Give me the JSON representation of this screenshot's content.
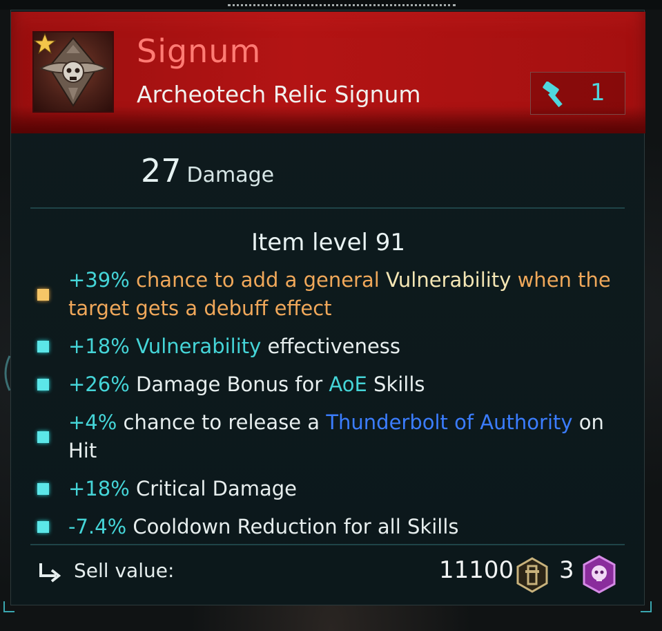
{
  "item": {
    "name": "Signum",
    "type": "Archeotech Relic Signum",
    "upgrade_count": "1",
    "damage_value": "27",
    "damage_label": "Damage",
    "item_level": "Item level 91"
  },
  "mods": [
    {
      "bullet": "gold",
      "parts": [
        {
          "t": "+39%",
          "c": "cyan"
        },
        {
          "t": " chance to add a general ",
          "c": "orange"
        },
        {
          "t": "Vulnerability",
          "c": "cream"
        },
        {
          "t": " when the target gets a debuff effect",
          "c": "orange"
        }
      ]
    },
    {
      "bullet": "cyan",
      "parts": [
        {
          "t": "+18%",
          "c": "cyan"
        },
        {
          "t": " "
        },
        {
          "t": "Vulnerability",
          "c": "cyan"
        },
        {
          "t": " effectiveness"
        }
      ]
    },
    {
      "bullet": "cyan",
      "parts": [
        {
          "t": "+26%",
          "c": "cyan"
        },
        {
          "t": " Damage Bonus for "
        },
        {
          "t": "AoE",
          "c": "cyan"
        },
        {
          "t": " Skills"
        }
      ]
    },
    {
      "bullet": "cyan",
      "parts": [
        {
          "t": "+4%",
          "c": "cyan"
        },
        {
          "t": " chance to release a "
        },
        {
          "t": "Thunderbolt of Authority",
          "c": "blue"
        },
        {
          "t": " on Hit"
        }
      ]
    },
    {
      "bullet": "cyan",
      "parts": [
        {
          "t": "+18%",
          "c": "cyan"
        },
        {
          "t": " Critical Damage"
        }
      ]
    },
    {
      "bullet": "cyan",
      "parts": [
        {
          "t": "-7.4%",
          "c": "cyan"
        },
        {
          "t": " Cooldown Reduction for all Skills"
        }
      ]
    }
  ],
  "footer": {
    "sell_label": "Sell value:",
    "sell_value": "11100",
    "secondary_value": "3"
  },
  "colors": {
    "header_red": "#b31414",
    "title_pink": "#ff7b74",
    "accent_cyan": "#45d5d8",
    "legendary_gold": "#f6c667",
    "blue_skill": "#3b7dff"
  },
  "icons": {
    "item_icon": "skull-aquila-signum-icon",
    "rarity": "star-icon",
    "upgrade": "hammer-icon",
    "sell": "return-arrow-icon",
    "currency": "coin-icon",
    "gem": "skull-gem-icon"
  }
}
